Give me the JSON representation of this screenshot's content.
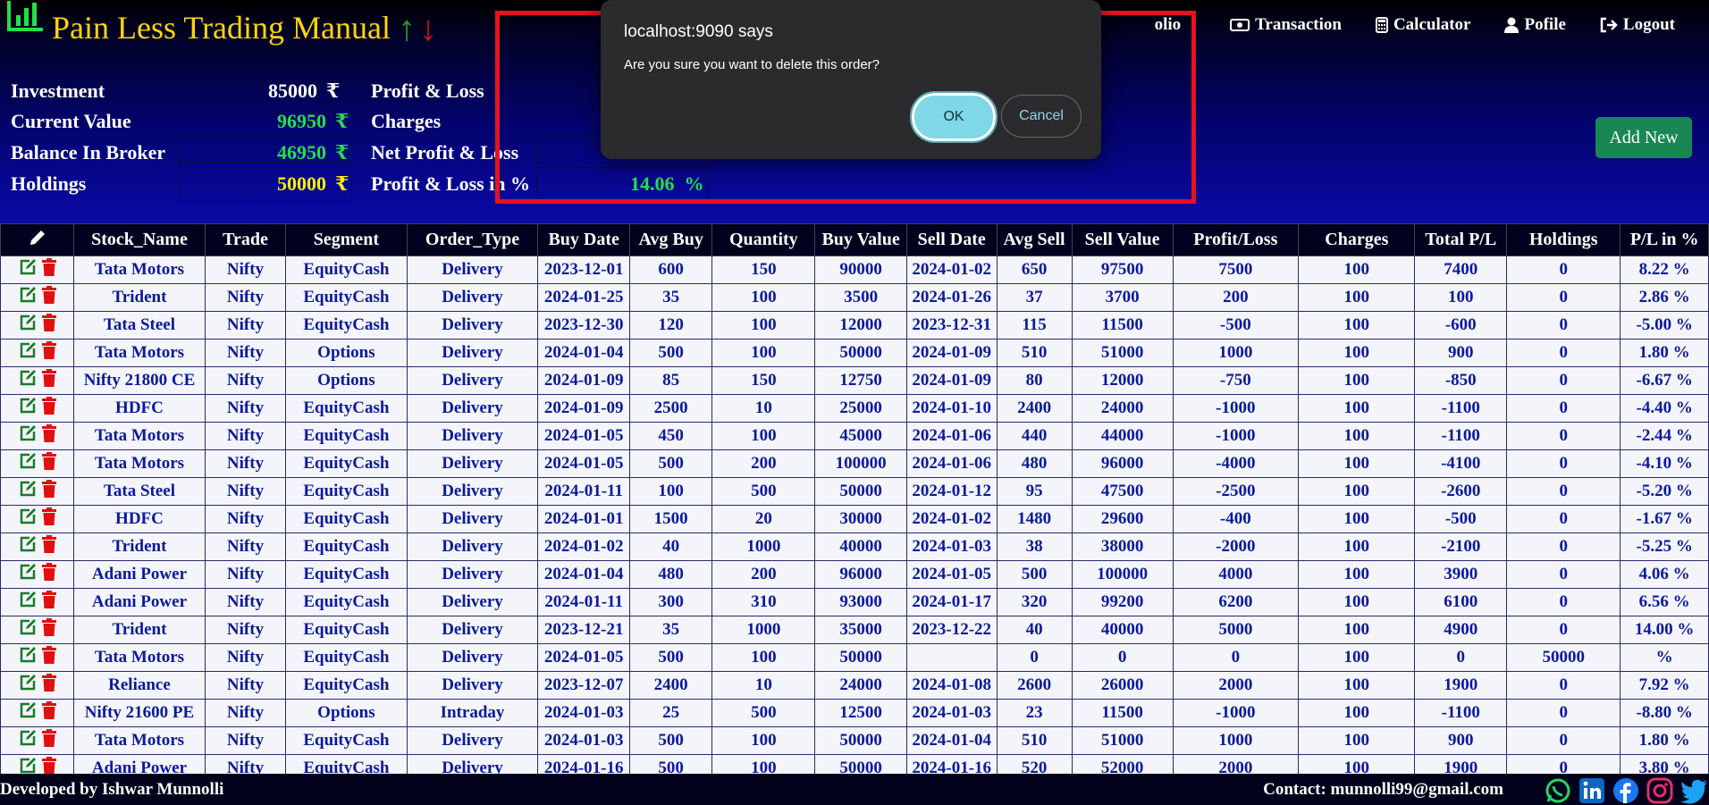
{
  "app": {
    "title": "Pain Less Trading Manual",
    "arrow_up": "↑",
    "arrow_down": "↓"
  },
  "nav": {
    "portfolio_partial": "olio",
    "transaction": "Transaction",
    "calculator": "Calculator",
    "profile": "Pofile",
    "logout": "Logout"
  },
  "summary": {
    "investment": {
      "label": "Investment",
      "value": "85000"
    },
    "current_value": {
      "label": "Current Value",
      "value": "96950"
    },
    "balance": {
      "label": "Balance In Broker",
      "value": "46950"
    },
    "holdings": {
      "label": "Holdings",
      "value": "50000"
    },
    "profit_loss": {
      "label": "Profit & Loss"
    },
    "charges": {
      "label": "Charges"
    },
    "net_pl": {
      "label": "Net Profit & Loss"
    },
    "pl_percent": {
      "label": "Profit & Loss in %",
      "value": "14.06",
      "unit": "%"
    },
    "currency": "₹"
  },
  "add_new": "Add New",
  "table": {
    "headers": [
      "Stock_Name",
      "Trade",
      "Segment",
      "Order_Type",
      "Buy Date",
      "Avg Buy",
      "Quantity",
      "Buy Value",
      "Sell Date",
      "Avg Sell",
      "Sell Value",
      "Profit/Loss",
      "Charges",
      "Total P/L",
      "Holdings",
      "P/L in %"
    ],
    "rows": [
      [
        "Tata Motors",
        "Nifty",
        "EquityCash",
        "Delivery",
        "2023-12-01",
        "600",
        "150",
        "90000",
        "2024-01-02",
        "650",
        "97500",
        "7500",
        "100",
        "7400",
        "0",
        "8.22 %"
      ],
      [
        "Trident",
        "Nifty",
        "EquityCash",
        "Delivery",
        "2024-01-25",
        "35",
        "100",
        "3500",
        "2024-01-26",
        "37",
        "3700",
        "200",
        "100",
        "100",
        "0",
        "2.86 %"
      ],
      [
        "Tata Steel",
        "Nifty",
        "EquityCash",
        "Delivery",
        "2023-12-30",
        "120",
        "100",
        "12000",
        "2023-12-31",
        "115",
        "11500",
        "-500",
        "100",
        "-600",
        "0",
        "-5.00 %"
      ],
      [
        "Tata Motors",
        "Nifty",
        "Options",
        "Delivery",
        "2024-01-04",
        "500",
        "100",
        "50000",
        "2024-01-09",
        "510",
        "51000",
        "1000",
        "100",
        "900",
        "0",
        "1.80 %"
      ],
      [
        "Nifty 21800 CE",
        "Nifty",
        "Options",
        "Delivery",
        "2024-01-09",
        "85",
        "150",
        "12750",
        "2024-01-09",
        "80",
        "12000",
        "-750",
        "100",
        "-850",
        "0",
        "-6.67 %"
      ],
      [
        "HDFC",
        "Nifty",
        "EquityCash",
        "Delivery",
        "2024-01-09",
        "2500",
        "10",
        "25000",
        "2024-01-10",
        "2400",
        "24000",
        "-1000",
        "100",
        "-1100",
        "0",
        "-4.40 %"
      ],
      [
        "Tata Motors",
        "Nifty",
        "EquityCash",
        "Delivery",
        "2024-01-05",
        "450",
        "100",
        "45000",
        "2024-01-06",
        "440",
        "44000",
        "-1000",
        "100",
        "-1100",
        "0",
        "-2.44 %"
      ],
      [
        "Tata Motors",
        "Nifty",
        "EquityCash",
        "Delivery",
        "2024-01-05",
        "500",
        "200",
        "100000",
        "2024-01-06",
        "480",
        "96000",
        "-4000",
        "100",
        "-4100",
        "0",
        "-4.10 %"
      ],
      [
        "Tata Steel",
        "Nifty",
        "EquityCash",
        "Delivery",
        "2024-01-11",
        "100",
        "500",
        "50000",
        "2024-01-12",
        "95",
        "47500",
        "-2500",
        "100",
        "-2600",
        "0",
        "-5.20 %"
      ],
      [
        "HDFC",
        "Nifty",
        "EquityCash",
        "Delivery",
        "2024-01-01",
        "1500",
        "20",
        "30000",
        "2024-01-02",
        "1480",
        "29600",
        "-400",
        "100",
        "-500",
        "0",
        "-1.67 %"
      ],
      [
        "Trident",
        "Nifty",
        "EquityCash",
        "Delivery",
        "2024-01-02",
        "40",
        "1000",
        "40000",
        "2024-01-03",
        "38",
        "38000",
        "-2000",
        "100",
        "-2100",
        "0",
        "-5.25 %"
      ],
      [
        "Adani Power",
        "Nifty",
        "EquityCash",
        "Delivery",
        "2024-01-04",
        "480",
        "200",
        "96000",
        "2024-01-05",
        "500",
        "100000",
        "4000",
        "100",
        "3900",
        "0",
        "4.06 %"
      ],
      [
        "Adani Power",
        "Nifty",
        "EquityCash",
        "Delivery",
        "2024-01-11",
        "300",
        "310",
        "93000",
        "2024-01-17",
        "320",
        "99200",
        "6200",
        "100",
        "6100",
        "0",
        "6.56 %"
      ],
      [
        "Trident",
        "Nifty",
        "EquityCash",
        "Delivery",
        "2023-12-21",
        "35",
        "1000",
        "35000",
        "2023-12-22",
        "40",
        "40000",
        "5000",
        "100",
        "4900",
        "0",
        "14.00 %"
      ],
      [
        "Tata Motors",
        "Nifty",
        "EquityCash",
        "Delivery",
        "2024-01-05",
        "500",
        "100",
        "50000",
        "",
        "0",
        "0",
        "0",
        "100",
        "0",
        "50000",
        "%"
      ],
      [
        "Reliance",
        "Nifty",
        "EquityCash",
        "Delivery",
        "2023-12-07",
        "2400",
        "10",
        "24000",
        "2024-01-08",
        "2600",
        "26000",
        "2000",
        "100",
        "1900",
        "0",
        "7.92 %"
      ],
      [
        "Nifty 21600 PE",
        "Nifty",
        "Options",
        "Intraday",
        "2024-01-03",
        "25",
        "500",
        "12500",
        "2024-01-03",
        "23",
        "11500",
        "-1000",
        "100",
        "-1100",
        "0",
        "-8.80 %"
      ],
      [
        "Tata Motors",
        "Nifty",
        "EquityCash",
        "Delivery",
        "2024-01-03",
        "500",
        "100",
        "50000",
        "2024-01-04",
        "510",
        "51000",
        "1000",
        "100",
        "900",
        "0",
        "1.80 %"
      ],
      [
        "Adani Power",
        "Nifty",
        "EquityCash",
        "Delivery",
        "2024-01-16",
        "500",
        "100",
        "50000",
        "2024-01-16",
        "520",
        "52000",
        "2000",
        "100",
        "1900",
        "0",
        "3.80 %"
      ]
    ]
  },
  "footer": {
    "developer": "Developed by Ishwar Munnolli",
    "contact": "Contact: munnolli99@gmail.com"
  },
  "dialog": {
    "title": "localhost:9090 says",
    "message": "Are you sure you want to delete this order?",
    "ok": "OK",
    "cancel": "Cancel"
  },
  "colors": {
    "title_yellow": "#ffd60a",
    "positive": "#0a8a0a",
    "negative": "#e01010",
    "value_green": "#22e04a",
    "value_yellow": "#ffee00",
    "highlight_red": "#e5131f"
  }
}
